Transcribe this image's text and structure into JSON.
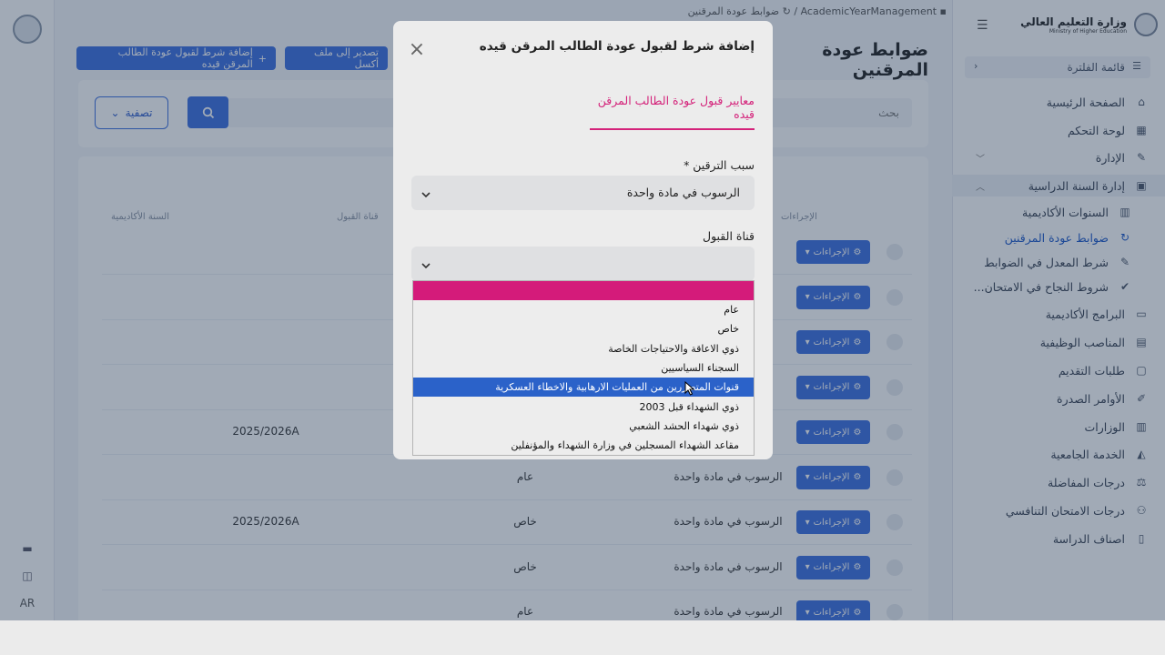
{
  "breadcrumb": {
    "parent": "AcademicYearManagement",
    "current": "ضوابط عودة المرقنين"
  },
  "page_title": "ضوابط عودة المرقنين",
  "toolbar": {
    "add_label": "إضافة شرط لقبول عودة الطالب المرقن قيده",
    "export_label": "تصدير إلى ملف أكسل"
  },
  "search": {
    "placeholder": "بحث",
    "filter_label": "تصفية"
  },
  "table": {
    "headers": [
      "الإجراءات",
      "قناة القبول",
      "السنة الأكاديمية"
    ],
    "action_label": "الإجراءات",
    "rows": [
      {
        "reason": "",
        "channel": "",
        "year": ""
      },
      {
        "reason": "",
        "channel": "",
        "year": ""
      },
      {
        "reason": "",
        "channel": "",
        "year": ""
      },
      {
        "reason": "",
        "channel": "",
        "year": ""
      },
      {
        "reason": "",
        "channel": "",
        "year": "2025/2026A"
      },
      {
        "reason": "الرسوب في مادة واحدة",
        "channel": "عام",
        "year": ""
      },
      {
        "reason": "الرسوب في مادة واحدة",
        "channel": "خاص",
        "year": "2025/2026A"
      },
      {
        "reason": "الرسوب في مادة واحدة",
        "channel": "خاص",
        "year": ""
      },
      {
        "reason": "الرسوب في مادة واحدة",
        "channel": "عام",
        "year": ""
      }
    ]
  },
  "sidebar": {
    "brand_title": "وزارة التعليم العالي",
    "brand_sub": "Ministry of Higher Education",
    "menu_head": "قائمة الفلترة",
    "items": [
      {
        "label": "الصفحة الرئيسية",
        "icon": "home-icon"
      },
      {
        "label": "لوحة التحكم",
        "icon": "dashboard-icon"
      },
      {
        "label": "الإدارة",
        "icon": "wrench-icon"
      },
      {
        "label": "إدارة السنة الدراسية",
        "icon": "calendar-icon"
      },
      {
        "label": "السنوات الأكاديمية",
        "icon": "building-icon"
      },
      {
        "label": "ضوابط عودة المرقنين",
        "icon": "sync-icon"
      },
      {
        "label": "شرط المعدل في الضوابط",
        "icon": "edit-icon"
      },
      {
        "label": "شروط النجاح في الامتحان...",
        "icon": "user-check-icon"
      },
      {
        "label": "البرامج الأكاديمية",
        "icon": "laptop-icon"
      },
      {
        "label": "المناصب الوظيفية",
        "icon": "book-icon"
      },
      {
        "label": "طلبات التقديم",
        "icon": "inbox-icon"
      },
      {
        "label": "الأوامر الصدرة",
        "icon": "pen-icon"
      },
      {
        "label": "الوزارات",
        "icon": "landmark-icon"
      },
      {
        "label": "الخدمة الجامعية",
        "icon": "graduation-icon"
      },
      {
        "label": "درجات المفاضلة",
        "icon": "scale-icon"
      },
      {
        "label": "درجات الامتحان التنافسي",
        "icon": "users-icon"
      },
      {
        "label": "اصناف الدراسة",
        "icon": "file-icon"
      }
    ]
  },
  "rail": {
    "lang": "AR"
  },
  "modal": {
    "title": "إضافة شرط لقبول عودة الطالب المرقن قيده",
    "tab": "معايير قبول عودة الطالب المرقن قيده",
    "reason_label": "سبب الترقين *",
    "reason_value": "الرسوب في مادة واحدة",
    "channel_label": "قناة القبول",
    "channel_value": "",
    "options": [
      "",
      "عام",
      "خاص",
      "ذوي الاعاقة والاحتياجات الخاصة",
      "السجناء السياسيين",
      "قنوات المتضررين من العمليات الارهابية والاخطاء العسكرية",
      "ذوي الشهداء قبل 2003",
      "ذوي شهداء الحشد الشعبي",
      "مقاعد الشهداء المسجلين في وزارة الشهداء والمؤنفلين"
    ],
    "selected_index": 5
  },
  "colors": {
    "primary": "#3b6ee0",
    "accent": "#d4227a",
    "selected": "#2b62c9"
  }
}
